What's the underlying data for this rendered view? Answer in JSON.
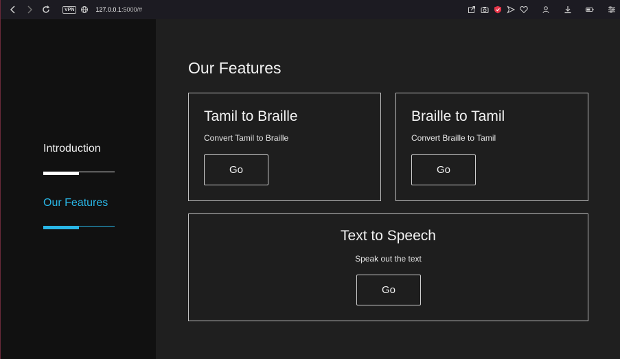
{
  "browser": {
    "vpn_label": "VPN",
    "url_host": "127.0.0.1",
    "url_rest": ":5000/#"
  },
  "sidebar": {
    "items": [
      {
        "label": "Introduction",
        "color": "#f2f2f2",
        "progress": 0.5
      },
      {
        "label": "Our Features",
        "color": "#29b6e6",
        "progress": 0.5,
        "active": true
      }
    ]
  },
  "main": {
    "title": "Our Features",
    "cards": [
      {
        "title": "Tamil to Braille",
        "desc": "Convert Tamil to Braille",
        "button": "Go"
      },
      {
        "title": "Braille to Tamil",
        "desc": "Convert Braille to Tamil",
        "button": "Go"
      },
      {
        "title": "Text to Speech",
        "desc": "Speak out the text",
        "button": "Go"
      }
    ]
  },
  "colors": {
    "accent": "#29b6e6",
    "main_bg": "#1f1f1f",
    "sidebar_bg": "#111111",
    "card_border": "#bfbfbf"
  }
}
